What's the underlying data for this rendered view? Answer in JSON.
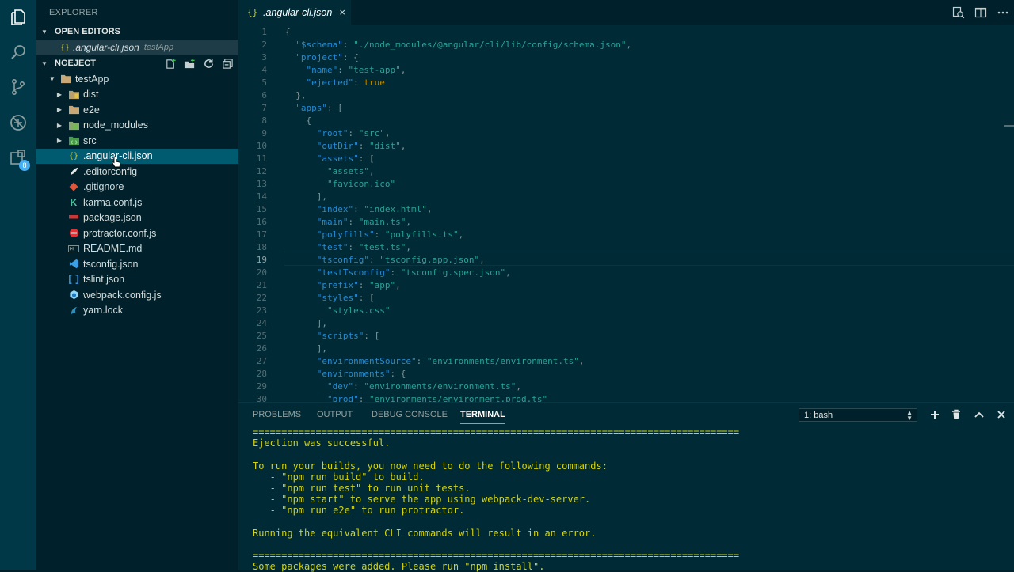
{
  "activity_bar": {
    "extensions_badge": "8"
  },
  "sidebar": {
    "title": "EXPLORER",
    "open_editors": {
      "header": "OPEN EDITORS",
      "item": {
        "icon": "{}",
        "name": ".angular-cli.json",
        "folder": "testApp"
      }
    },
    "project": {
      "header": "NGEJECT",
      "root": "testApp",
      "folders": [
        {
          "name": "dist",
          "icon": "folder-icon"
        },
        {
          "name": "e2e",
          "icon": "folder-icon"
        },
        {
          "name": "node_modules",
          "icon": "folder-icon"
        },
        {
          "name": "src",
          "icon": "folder-icon"
        }
      ],
      "files": [
        {
          "name": ".angular-cli.json",
          "icon": "json-icon",
          "selected": true
        },
        {
          "name": ".editorconfig",
          "icon": "editorconfig-icon"
        },
        {
          "name": ".gitignore",
          "icon": "git-icon"
        },
        {
          "name": "karma.conf.js",
          "icon": "karma-icon"
        },
        {
          "name": "package.json",
          "icon": "npm-icon"
        },
        {
          "name": "protractor.conf.js",
          "icon": "protractor-icon"
        },
        {
          "name": "README.md",
          "icon": "markdown-icon"
        },
        {
          "name": "tsconfig.json",
          "icon": "vscode-icon"
        },
        {
          "name": "tslint.json",
          "icon": "tslint-icon"
        },
        {
          "name": "webpack.config.js",
          "icon": "webpack-icon"
        },
        {
          "name": "yarn.lock",
          "icon": "yarn-icon"
        }
      ]
    }
  },
  "editor": {
    "tab": {
      "icon": "{}",
      "name": ".angular-cli.json",
      "close": "×"
    },
    "lines": [
      "{",
      "  \"$schema\": \"./node_modules/@angular/cli/lib/config/schema.json\",",
      "  \"project\": {",
      "    \"name\": \"test-app\",",
      "    \"ejected\": true",
      "  },",
      "  \"apps\": [",
      "    {",
      "      \"root\": \"src\",",
      "      \"outDir\": \"dist\",",
      "      \"assets\": [",
      "        \"assets\",",
      "        \"favicon.ico\"",
      "      ],",
      "      \"index\": \"index.html\",",
      "      \"main\": \"main.ts\",",
      "      \"polyfills\": \"polyfills.ts\",",
      "      \"test\": \"test.ts\",",
      "      \"tsconfig\": \"tsconfig.app.json\",",
      "      \"testTsconfig\": \"tsconfig.spec.json\",",
      "      \"prefix\": \"app\",",
      "      \"styles\": [",
      "        \"styles.css\"",
      "      ],",
      "      \"scripts\": [",
      "      ],",
      "      \"environmentSource\": \"environments/environment.ts\",",
      "      \"environments\": {",
      "        \"dev\": \"environments/environment.ts\",",
      "        \"prod\": \"environments/environment.prod.ts\""
    ],
    "highlighted_line": 19
  },
  "panel": {
    "tabs": [
      "PROBLEMS",
      "OUTPUT",
      "DEBUG CONSOLE",
      "TERMINAL"
    ],
    "active_tab": "TERMINAL",
    "terminal_select": "1: bash",
    "terminal_lines": [
      "=====================================================================================",
      "Ejection was successful.",
      "",
      "To run your builds, you now need to do the following commands:",
      "   - \"npm run build\" to build.",
      "   - \"npm run test\" to run unit tests.",
      "   - \"npm start\" to serve the app using webpack-dev-server.",
      "   - \"npm run e2e\" to run protractor.",
      "",
      "Running the equivalent CLI commands will result in an error.",
      "",
      "=====================================================================================",
      "Some packages were added. Please run \"npm install\"."
    ]
  },
  "colors": {
    "background": "#002b36",
    "sidebar": "#00212b",
    "activity_bar": "#003847",
    "selection": "#005a70",
    "json_key": "#268bd2",
    "json_string": "#2aa198",
    "terminal_text": "#d4d40e"
  }
}
